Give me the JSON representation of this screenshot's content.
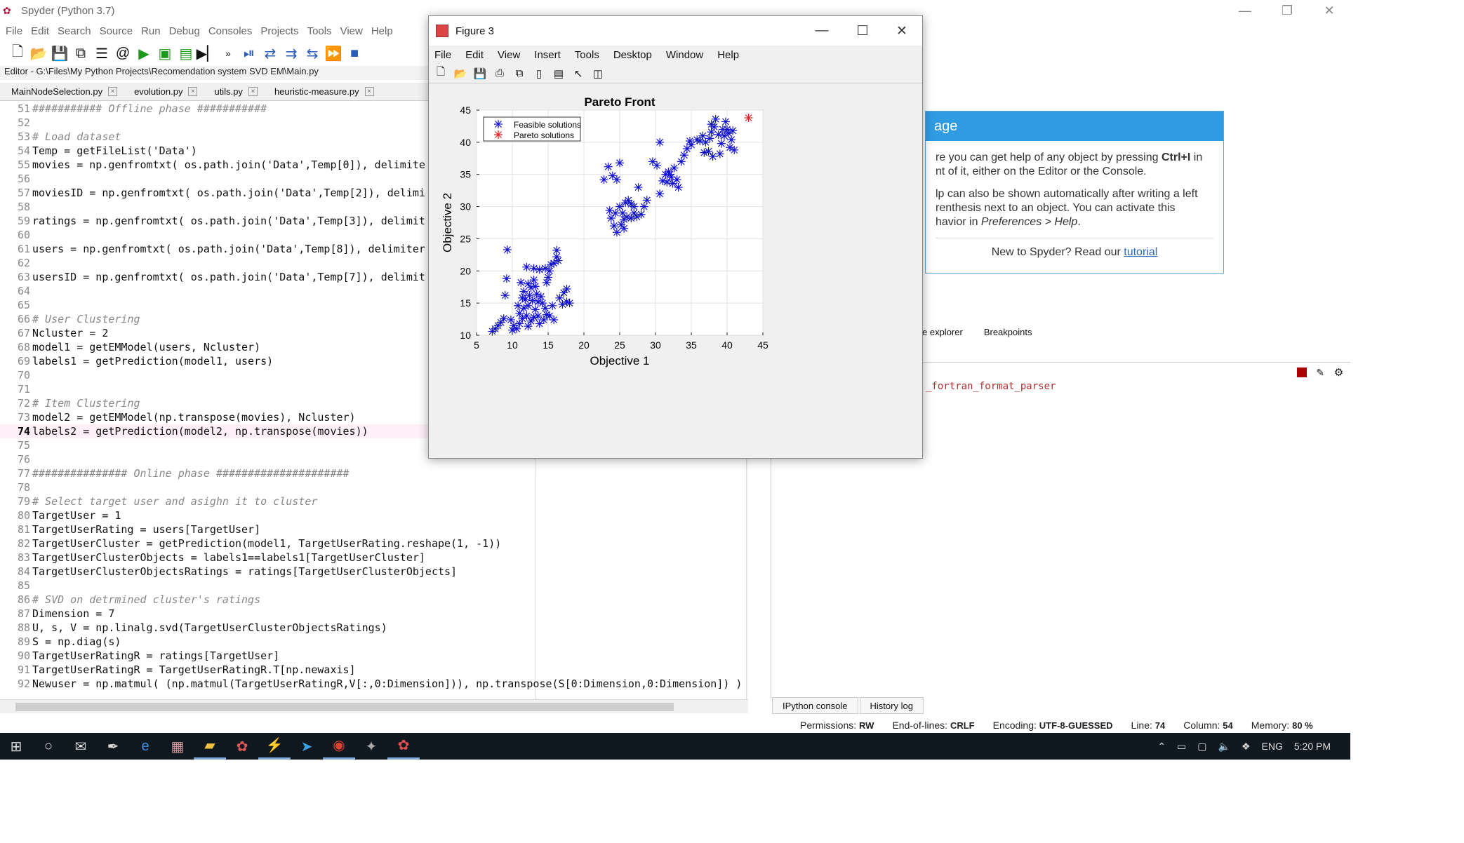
{
  "window": {
    "title": "Spyder (Python 3.7)"
  },
  "menubar": [
    "File",
    "Edit",
    "Search",
    "Source",
    "Run",
    "Debug",
    "Consoles",
    "Projects",
    "Tools",
    "View",
    "Help"
  ],
  "editor": {
    "path": "Editor - G:\\Files\\My Python Projects\\Recomendation system SVD EM\\Main.py",
    "tabs": [
      "MainNodeSelection.py",
      "evolution.py",
      "utils.py",
      "heuristic-measure.py"
    ],
    "lines": [
      {
        "n": "51",
        "t": "########### Offline phase ###########",
        "c": "comment"
      },
      {
        "n": "52",
        "t": ""
      },
      {
        "n": "53",
        "t": "# Load dataset",
        "c": "comment"
      },
      {
        "n": "54",
        "t": "Temp = getFileList('Data')"
      },
      {
        "n": "55",
        "t": "movies = np.genfromtxt( os.path.join('Data',Temp[0]), delimite"
      },
      {
        "n": "56",
        "t": ""
      },
      {
        "n": "57",
        "t": "moviesID = np.genfromtxt( os.path.join('Data',Temp[2]), delimi"
      },
      {
        "n": "58",
        "t": ""
      },
      {
        "n": "59",
        "t": "ratings = np.genfromtxt( os.path.join('Data',Temp[3]), delimit"
      },
      {
        "n": "60",
        "t": ""
      },
      {
        "n": "61",
        "t": "users = np.genfromtxt( os.path.join('Data',Temp[8]), delimiter"
      },
      {
        "n": "62",
        "t": ""
      },
      {
        "n": "63",
        "t": "usersID = np.genfromtxt( os.path.join('Data',Temp[7]), delimit"
      },
      {
        "n": "64",
        "t": ""
      },
      {
        "n": "65",
        "t": ""
      },
      {
        "n": "66",
        "t": "# User Clustering",
        "c": "comment"
      },
      {
        "n": "67",
        "t": "Ncluster = 2"
      },
      {
        "n": "68",
        "t": "model1 = getEMModel(users, Ncluster)"
      },
      {
        "n": "69",
        "t": "labels1 = getPrediction(model1, users)"
      },
      {
        "n": "70",
        "t": ""
      },
      {
        "n": "71",
        "t": ""
      },
      {
        "n": "72",
        "t": "# Item Clustering",
        "c": "comment"
      },
      {
        "n": "73",
        "t": "model2 = getEMModel(np.transpose(movies), Ncluster)"
      },
      {
        "n": "74",
        "t": "labels2 = getPrediction(model2, np.transpose(movies))",
        "cur": true
      },
      {
        "n": "75",
        "t": ""
      },
      {
        "n": "76",
        "t": ""
      },
      {
        "n": "77",
        "t": "############### Online phase #####################",
        "c": "comment"
      },
      {
        "n": "78",
        "t": ""
      },
      {
        "n": "79",
        "t": "# Select target user and asighn it to cluster",
        "c": "comment"
      },
      {
        "n": "80",
        "t": "TargetUser = 1"
      },
      {
        "n": "81",
        "t": "TargetUserRating = users[TargetUser]"
      },
      {
        "n": "82",
        "t": "TargetUserCluster = getPrediction(model1, TargetUserRating.reshape(1, -1))"
      },
      {
        "n": "83",
        "t": "TargetUserClusterObjects = labels1==labels1[TargetUserCluster]"
      },
      {
        "n": "84",
        "t": "TargetUserClusterObjectsRatings = ratings[TargetUserClusterObjects]"
      },
      {
        "n": "85",
        "t": ""
      },
      {
        "n": "86",
        "t": "# SVD on detrmined cluster's ratings",
        "c": "comment"
      },
      {
        "n": "87",
        "t": "Dimension = 7"
      },
      {
        "n": "88",
        "t": "U, s, V = np.linalg.svd(TargetUserClusterObjectsRatings)"
      },
      {
        "n": "89",
        "t": "S = np.diag(s)"
      },
      {
        "n": "90",
        "t": "TargetUserRatingR = ratings[TargetUser]"
      },
      {
        "n": "91",
        "t": "TargetUserRatingR = TargetUserRatingR.T[np.newaxis]"
      },
      {
        "n": "92",
        "t": "Newuser = np.matmul( (np.matmul(TargetUserRatingR,V[:,0:Dimension])), np.transpose(S[0:Dimension,0:Dimension]) )"
      }
    ]
  },
  "help": {
    "header": "age",
    "p1a": "re you can get help of any object by pressing ",
    "p1b": "Ctrl+I",
    "p1c": " in",
    "p1d": "nt of it, either on the Editor or the Console.",
    "p2a": "lp can also be shown automatically after writing a left",
    "p2b": "renthesis next to an object. You can activate this",
    "p2c": "havior in ",
    "p2d": "Preferences > Help",
    "p2e": ".",
    "tutorial_prefix": "New to Spyder? Read our ",
    "tutorial_link": "tutorial"
  },
  "right_tabs": [
    "e explorer",
    "Breakpoints"
  ],
  "console_text": "_fortran_format_parser",
  "console_tabs": [
    "IPython console",
    "History log"
  ],
  "status": {
    "permissions_label": "Permissions:",
    "permissions": "RW",
    "eol_label": "End-of-lines:",
    "eol": "CRLF",
    "encoding_label": "Encoding:",
    "encoding": "UTF-8-GUESSED",
    "line_label": "Line:",
    "line": "74",
    "column_label": "Column:",
    "column": "54",
    "memory_label": "Memory:",
    "memory": "80 %"
  },
  "tray": {
    "lang": "ENG",
    "time": "5:20 PM"
  },
  "figure": {
    "title": "Figure 3",
    "menu": [
      "File",
      "Edit",
      "View",
      "Insert",
      "Tools",
      "Desktop",
      "Window",
      "Help"
    ]
  },
  "chart_data": {
    "type": "scatter",
    "title": "Pareto Front",
    "xlabel": "Objective 1",
    "ylabel": "Objective 2",
    "xlim": [
      5,
      45
    ],
    "ylim": [
      10,
      45
    ],
    "xticks": [
      5,
      10,
      15,
      20,
      25,
      30,
      35,
      40,
      45
    ],
    "yticks": [
      10,
      15,
      20,
      25,
      30,
      35,
      40,
      45
    ],
    "legend_position": "top-left",
    "marker": "asterisk",
    "colors": {
      "feasible": "#1010d0",
      "pareto": "#e02020"
    },
    "series": [
      {
        "name": "Feasible solutions",
        "points": [
          [
            9.3,
            23.3
          ],
          [
            9.2,
            18.8
          ],
          [
            9.0,
            16.2
          ],
          [
            7.6,
            11.0
          ],
          [
            8.0,
            11.5
          ],
          [
            8.4,
            12.0
          ],
          [
            8.8,
            12.6
          ],
          [
            7.2,
            10.6
          ],
          [
            10.0,
            10.8
          ],
          [
            10.2,
            11.5
          ],
          [
            9.8,
            12.4
          ],
          [
            10.6,
            11.0
          ],
          [
            11.0,
            11.8
          ],
          [
            11.4,
            12.6
          ],
          [
            11.0,
            13.4
          ],
          [
            11.6,
            14.2
          ],
          [
            12.0,
            13.0
          ],
          [
            12.2,
            14.6
          ],
          [
            11.8,
            15.6
          ],
          [
            12.4,
            16.2
          ],
          [
            12.6,
            17.4
          ],
          [
            12.2,
            18.0
          ],
          [
            13.0,
            18.6
          ],
          [
            13.2,
            17.6
          ],
          [
            13.4,
            16.4
          ],
          [
            13.6,
            15.2
          ],
          [
            13.2,
            14.0
          ],
          [
            13.0,
            12.8
          ],
          [
            12.6,
            12.2
          ],
          [
            12.2,
            11.4
          ],
          [
            13.8,
            11.8
          ],
          [
            14.4,
            12.4
          ],
          [
            14.8,
            13.2
          ],
          [
            14.6,
            14.2
          ],
          [
            14.2,
            15.0
          ],
          [
            14.0,
            16.0
          ],
          [
            14.8,
            18.2
          ],
          [
            15.0,
            19.0
          ],
          [
            15.2,
            20.0
          ],
          [
            15.8,
            21.2
          ],
          [
            16.2,
            22.2
          ],
          [
            16.4,
            21.6
          ],
          [
            15.4,
            21.0
          ],
          [
            14.6,
            20.4
          ],
          [
            13.8,
            20.2
          ],
          [
            13.0,
            20.4
          ],
          [
            12.0,
            20.6
          ],
          [
            11.2,
            18.2
          ],
          [
            11.6,
            16.8
          ],
          [
            16.2,
            23.2
          ],
          [
            15.6,
            14.6
          ],
          [
            15.2,
            13.0
          ],
          [
            15.8,
            12.4
          ],
          [
            17.0,
            14.8
          ],
          [
            17.6,
            15.2
          ],
          [
            17.2,
            16.6
          ],
          [
            17.6,
            17.2
          ],
          [
            16.6,
            15.8
          ],
          [
            18.0,
            15.0
          ],
          [
            10.8,
            14.6
          ],
          [
            11.4,
            15.8
          ],
          [
            12.8,
            15.4
          ],
          [
            13.6,
            13.0
          ],
          [
            22.8,
            34.2
          ],
          [
            23.4,
            36.2
          ],
          [
            24.0,
            34.8
          ],
          [
            24.6,
            34.2
          ],
          [
            25.0,
            36.8
          ],
          [
            24.6,
            26.0
          ],
          [
            24.2,
            27.0
          ],
          [
            23.8,
            28.2
          ],
          [
            23.6,
            29.4
          ],
          [
            24.4,
            29.0
          ],
          [
            25.0,
            30.0
          ],
          [
            25.4,
            29.0
          ],
          [
            25.6,
            28.0
          ],
          [
            25.2,
            27.2
          ],
          [
            25.6,
            26.6
          ],
          [
            26.0,
            28.4
          ],
          [
            26.6,
            28.2
          ],
          [
            27.0,
            29.0
          ],
          [
            27.4,
            28.4
          ],
          [
            27.0,
            30.0
          ],
          [
            26.6,
            30.4
          ],
          [
            25.8,
            30.6
          ],
          [
            26.2,
            31.0
          ],
          [
            27.6,
            33.0
          ],
          [
            28.0,
            28.8
          ],
          [
            28.4,
            30.0
          ],
          [
            28.8,
            31.0
          ],
          [
            29.6,
            37.0
          ],
          [
            30.2,
            36.4
          ],
          [
            30.6,
            32.0
          ],
          [
            30.6,
            40.0
          ],
          [
            31.0,
            34.0
          ],
          [
            31.4,
            35.0
          ],
          [
            31.8,
            35.4
          ],
          [
            32.0,
            35.0
          ],
          [
            32.2,
            34.6
          ],
          [
            32.6,
            36.0
          ],
          [
            33.0,
            34.2
          ],
          [
            33.2,
            33.0
          ],
          [
            32.4,
            33.6
          ],
          [
            31.6,
            33.8
          ],
          [
            33.6,
            37.0
          ],
          [
            34.0,
            38.0
          ],
          [
            34.4,
            39.0
          ],
          [
            34.8,
            40.2
          ],
          [
            35.0,
            39.6
          ],
          [
            35.8,
            40.4
          ],
          [
            36.2,
            40.2
          ],
          [
            36.6,
            41.0
          ],
          [
            37.0,
            40.0
          ],
          [
            37.4,
            38.6
          ],
          [
            37.6,
            40.6
          ],
          [
            37.8,
            41.6
          ],
          [
            38.2,
            42.4
          ],
          [
            38.4,
            43.6
          ],
          [
            38.8,
            41.2
          ],
          [
            39.2,
            39.8
          ],
          [
            39.6,
            41.0
          ],
          [
            40.0,
            42.0
          ],
          [
            40.2,
            41.4
          ],
          [
            40.4,
            39.2
          ],
          [
            40.8,
            41.8
          ],
          [
            41.0,
            38.8
          ],
          [
            39.0,
            38.2
          ],
          [
            39.8,
            43.2
          ],
          [
            37.8,
            42.8
          ],
          [
            36.8,
            38.4
          ],
          [
            38.0,
            37.8
          ],
          [
            39.4,
            42.0
          ],
          [
            40.6,
            40.4
          ]
        ]
      },
      {
        "name": "Pareto solutions",
        "points": [
          [
            43.0,
            43.8
          ]
        ]
      }
    ]
  }
}
